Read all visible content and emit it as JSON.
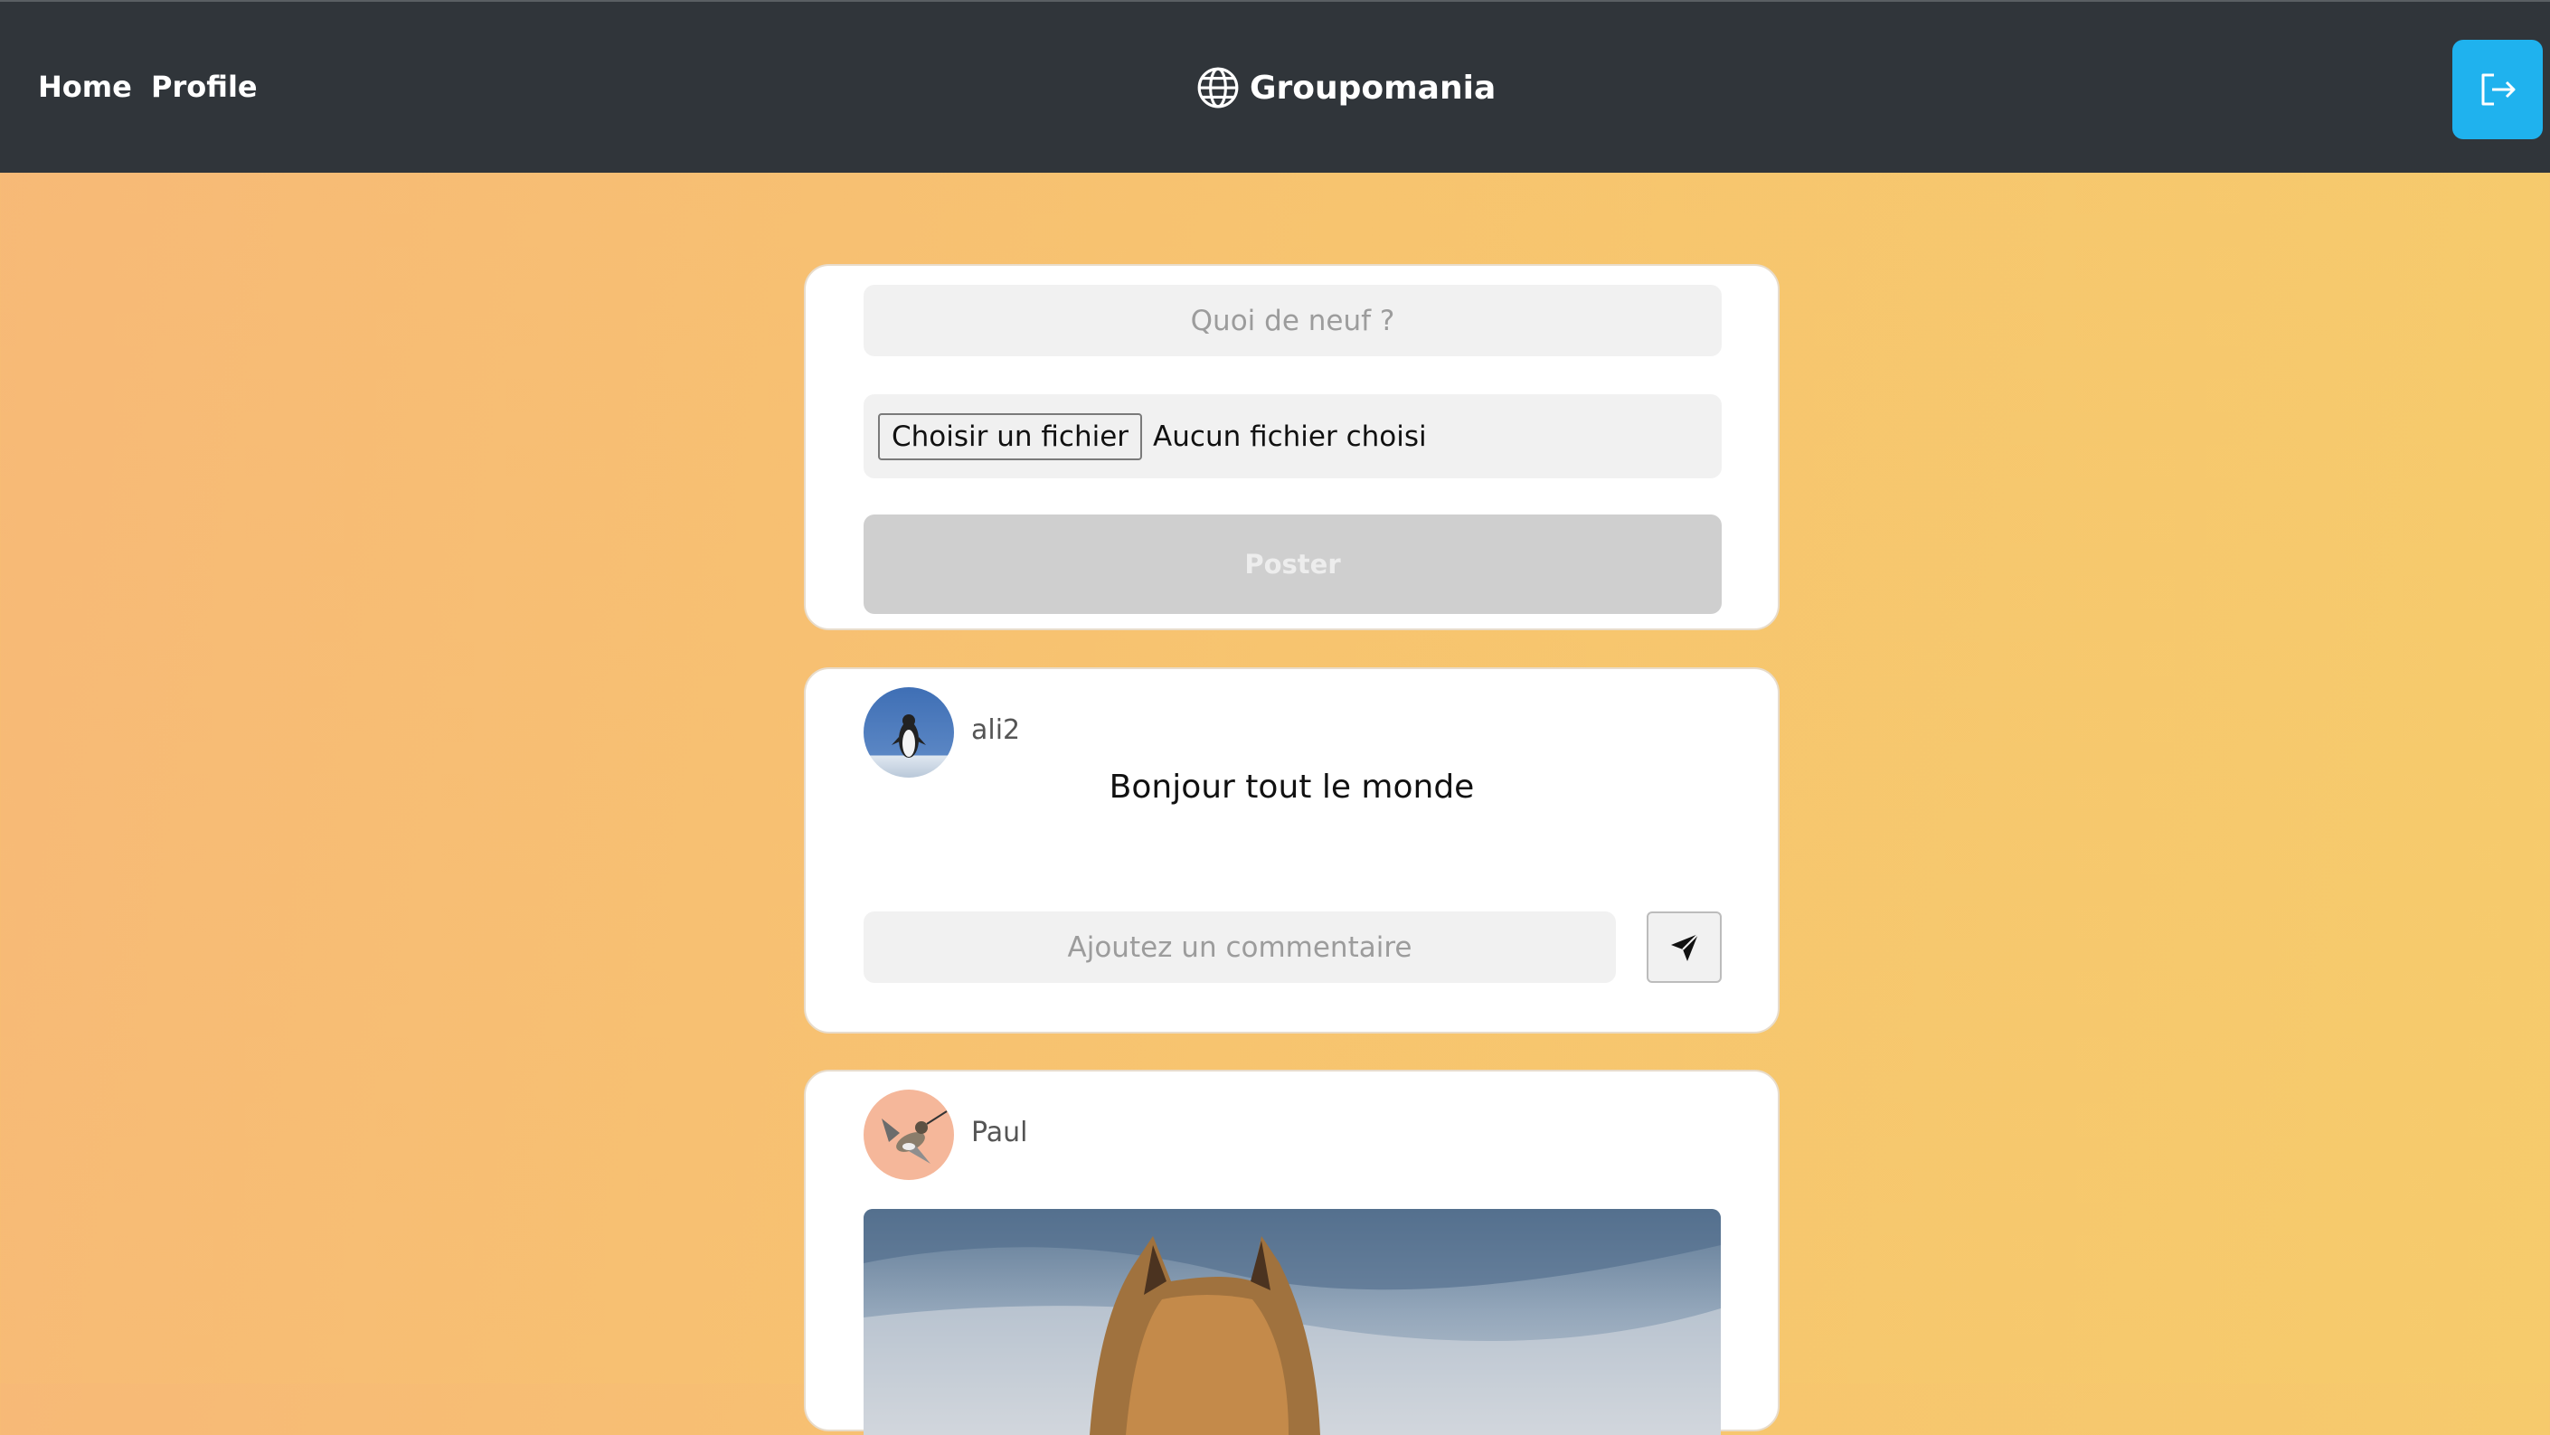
{
  "nav": {
    "home_label": "Home",
    "profile_label": "Profile",
    "brand_name": "Groupomania",
    "brand_icon": "globe-icon",
    "logout_icon": "logout-icon",
    "logout_color": "#1fb2ee"
  },
  "composer": {
    "text_placeholder": "Quoi de neuf ?",
    "file_button_label": "Choisir un fichier",
    "file_status": "Aucun fichier choisi",
    "post_button_label": "Poster"
  },
  "posts": [
    {
      "author": "ali2",
      "avatar": "penguin-avatar",
      "text": "Bonjour tout le monde",
      "comment_placeholder": "Ajoutez un commentaire",
      "send_icon": "send-icon"
    },
    {
      "author": "Paul",
      "avatar": "hummingbird-avatar",
      "image": "horse-image"
    }
  ],
  "colors": {
    "navbar": "#30353a",
    "background_start": "#f7b977",
    "background_end": "#f6cb6c",
    "card": "#ffffff"
  }
}
